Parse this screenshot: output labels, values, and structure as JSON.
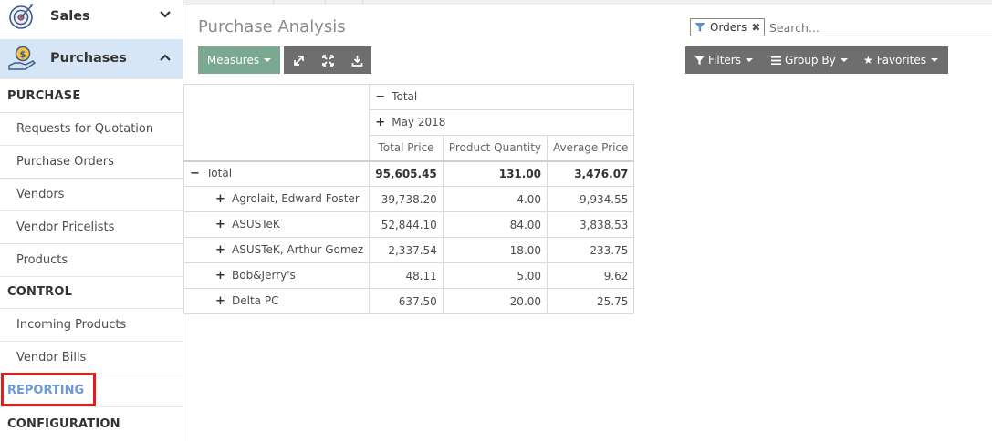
{
  "sidebar": {
    "apps": {
      "sales": {
        "label": "Sales",
        "icon": "target-icon"
      },
      "purchases": {
        "label": "Purchases",
        "icon": "hand-coin-icon"
      }
    },
    "sections": {
      "purchase": "PURCHASE",
      "control": "CONTROL",
      "reporting": "REPORTING",
      "configuration": "CONFIGURATION"
    },
    "purchase_items": [
      "Requests for Quotation",
      "Purchase Orders",
      "Vendors",
      "Vendor Pricelists",
      "Products"
    ],
    "control_items": [
      "Incoming Products",
      "Vendor Bills"
    ]
  },
  "header": {
    "title": "Purchase Analysis",
    "search": {
      "facet_label": "Orders",
      "placeholder": "Search..."
    }
  },
  "toolbar": {
    "measures_label": "Measures",
    "filters_label": "Filters",
    "group_by_label": "Group By",
    "favorites_label": "Favorites"
  },
  "pivot": {
    "col_total_label": "Total",
    "col_group_label": "May 2018",
    "measures": [
      "Total Price",
      "Product Quantity",
      "Average Price"
    ],
    "total_row": {
      "label": "Total",
      "values": [
        "95,605.45",
        "131.00",
        "3,476.07"
      ]
    },
    "rows": [
      {
        "label": "Agrolait, Edward Foster",
        "values": [
          "39,738.20",
          "4.00",
          "9,934.55"
        ]
      },
      {
        "label": "ASUSTeK",
        "values": [
          "52,844.10",
          "84.00",
          "3,838.53"
        ]
      },
      {
        "label": "ASUSTeK, Arthur Gomez",
        "values": [
          "2,337.54",
          "18.00",
          "233.75"
        ]
      },
      {
        "label": "Bob&Jerry's",
        "values": [
          "48.11",
          "5.00",
          "9.62"
        ]
      },
      {
        "label": "Delta PC",
        "values": [
          "637.50",
          "20.00",
          "25.75"
        ]
      }
    ]
  },
  "colors": {
    "measures_button": "#7aa890",
    "toolbar_grey": "#6e6e6e",
    "active_app_bg": "#d7e6f7",
    "reporting_text": "#6d9bd8",
    "highlight_box": "#e11d1d"
  }
}
